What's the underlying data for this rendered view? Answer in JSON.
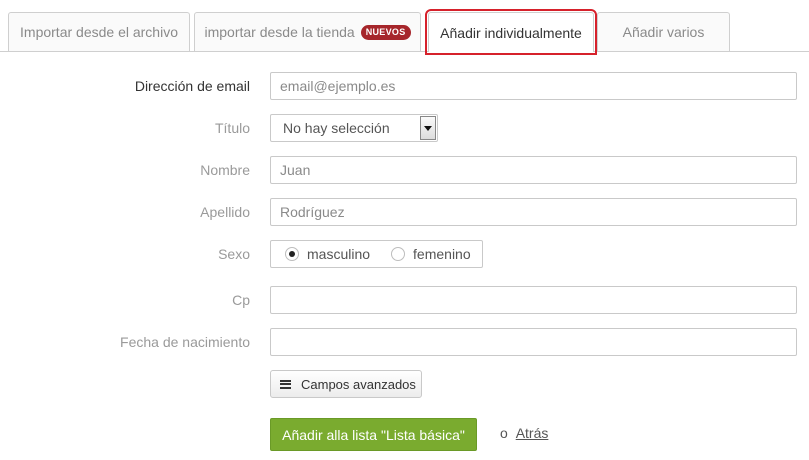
{
  "tabs": [
    {
      "label": "Importar desde el archivo"
    },
    {
      "label": "importar desde la tienda",
      "badge": "NUEVOS"
    },
    {
      "label": "Añadir individualmente",
      "active": true
    },
    {
      "label": "Añadir varios"
    }
  ],
  "form": {
    "email": {
      "label": "Dirección de email",
      "value": "",
      "placeholder": "email@ejemplo.es"
    },
    "title": {
      "label": "Título",
      "selected": "No hay selección"
    },
    "first_name": {
      "label": "Nombre",
      "value": "",
      "placeholder": "Juan"
    },
    "last_name": {
      "label": "Apellido",
      "value": "",
      "placeholder": "Rodríguez"
    },
    "sex": {
      "label": "Sexo",
      "options": [
        "masculino",
        "femenino"
      ],
      "selected": "masculino"
    },
    "zip": {
      "label": "Cp",
      "value": ""
    },
    "birthdate": {
      "label": "Fecha de nacimiento",
      "value": ""
    }
  },
  "advanced_button": "Campos avanzados",
  "submit_button": "Añadir alla lista \"Lista básica\"",
  "or_text": "o",
  "back_link": "Atrás",
  "colors": {
    "accent_green": "#7aab2f",
    "active_tab_outline": "#d6212b",
    "badge": "#a6262b"
  }
}
